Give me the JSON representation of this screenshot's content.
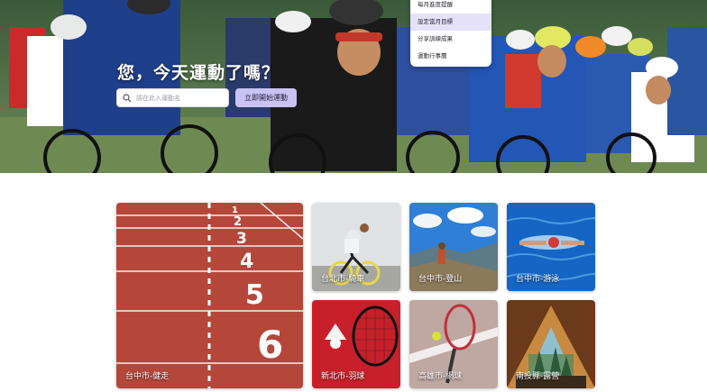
{
  "hero": {
    "title": "您，今天運動了嗎？",
    "search_placeholder": "請在此入運動名",
    "start_button": "立即開始運動"
  },
  "menu": {
    "items": [
      {
        "label": "每月進度提醒",
        "active": false
      },
      {
        "label": "設定當月目標",
        "active": true
      },
      {
        "label": "分享訓練成果",
        "active": false
      },
      {
        "label": "運動行事曆",
        "active": false
      }
    ]
  },
  "cards": [
    {
      "label": "台中市-健走",
      "scene": "track"
    },
    {
      "label": "台北市-騎車",
      "scene": "cycling"
    },
    {
      "label": "台中市-登山",
      "scene": "hiking"
    },
    {
      "label": "台中市-游泳",
      "scene": "swimming"
    },
    {
      "label": "新北市-羽球",
      "scene": "badminton"
    },
    {
      "label": "高雄市-網球",
      "scene": "tennis"
    },
    {
      "label": "南投縣-露營",
      "scene": "camping"
    }
  ]
}
